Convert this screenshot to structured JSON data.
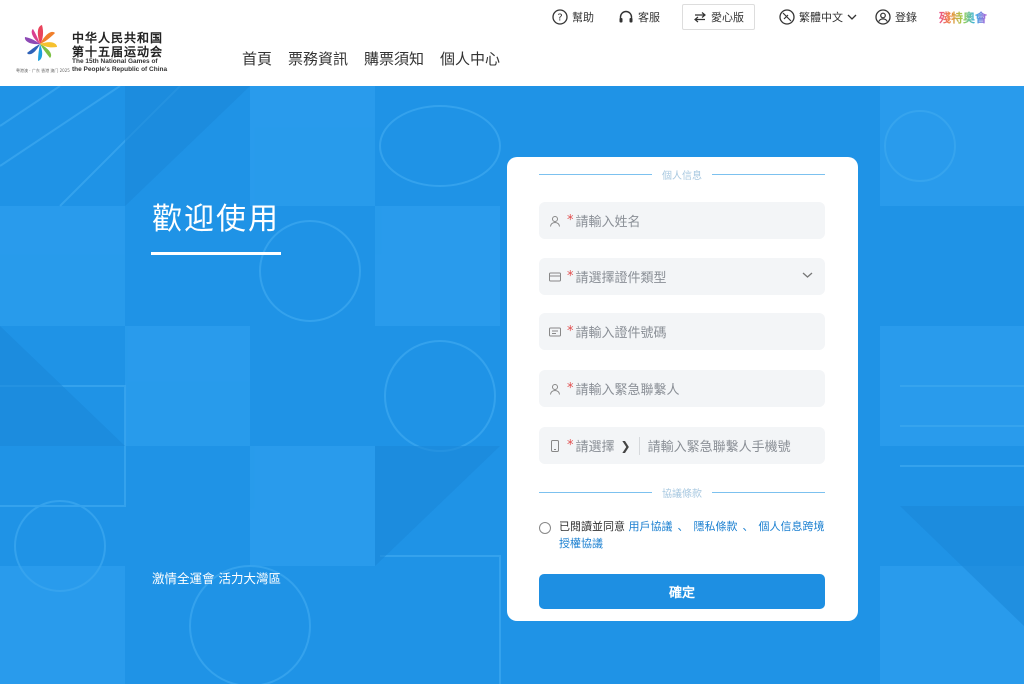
{
  "header": {
    "logo": {
      "cn_line1": "中华人民共和国",
      "cn_line2": "第十五届运动会",
      "en_line1": "The 15th National Games of",
      "en_line2": "the People's Republic of China",
      "sub": "粤港澳 · 广东 香港 澳门 2025"
    },
    "nav": [
      "首頁",
      "票務資訊",
      "購票須知",
      "個人中心"
    ],
    "topbar": {
      "help": "幫助",
      "service": "客服",
      "care": "愛心版",
      "language": "繁體中文",
      "login": "登錄",
      "paralympic": "殘特奧會"
    }
  },
  "hero": {
    "welcome": "歡迎使用",
    "slogan": "激情全運會 活力大灣區"
  },
  "form": {
    "section_personal": "個人信息",
    "name_placeholder": "請輸入姓名",
    "id_type_placeholder": "請選擇證件類型",
    "id_number_placeholder": "請輸入證件號碼",
    "emergency_contact_placeholder": "請輸入緊急聯繫人",
    "area_code_select": "請選擇",
    "emergency_phone_placeholder": "請輸入緊急聯繫人手機號",
    "required_mark": "*",
    "section_terms": "協議條款",
    "agree_prefix": "已閱讀並同意",
    "user_agreement": "用戶協議",
    "separator": "、",
    "privacy_terms": "隱私條款",
    "cross_border": "個人信息跨境授權協議",
    "submit": "確定"
  },
  "colors": {
    "brand_blue": "#1f93e6",
    "required_red": "#e14b4b",
    "link_blue": "#1a7fd0"
  }
}
